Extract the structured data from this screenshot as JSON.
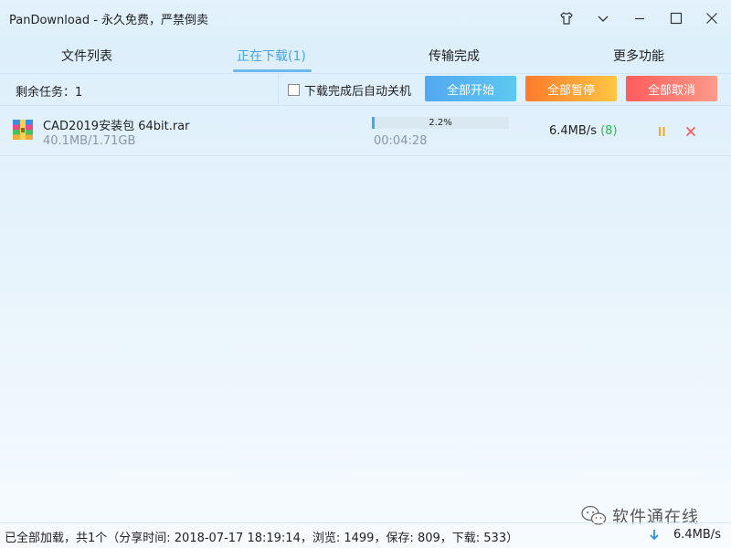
{
  "window": {
    "title": "PanDownload - 永久免费，严禁倒卖"
  },
  "tabs": [
    {
      "label": "文件列表"
    },
    {
      "label": "正在下载(1)"
    },
    {
      "label": "传输完成"
    },
    {
      "label": "更多功能"
    }
  ],
  "toolbar": {
    "remaining": "剩余任务：1",
    "shutdown_label": "下载完成后自动关机",
    "start_all": "全部开始",
    "pause_all": "全部暂停",
    "cancel_all": "全部取消"
  },
  "download": {
    "file_name": "CAD2019安装包 64bit.rar",
    "size": "40.1MB/1.71GB",
    "progress": 0.022,
    "progress_text": "2.2%",
    "eta": "00:04:28",
    "speed": "6.4MB/s",
    "connections": "(8)"
  },
  "statusbar": {
    "text": "已全部加载，共1个（分享时间: 2018-07-17 18:19:14，浏览: 1499，保存: 809，下载: 533）",
    "speed": "6.4MB/s"
  },
  "watermark": {
    "text": "软件通在线"
  },
  "colors": {
    "accent": "#4aa3df",
    "progress": "#35b0e8",
    "start": "#53a8f0",
    "pause": "#ff7a2b",
    "cancel": "#ff5c5c",
    "connections": "#2ab64a"
  }
}
